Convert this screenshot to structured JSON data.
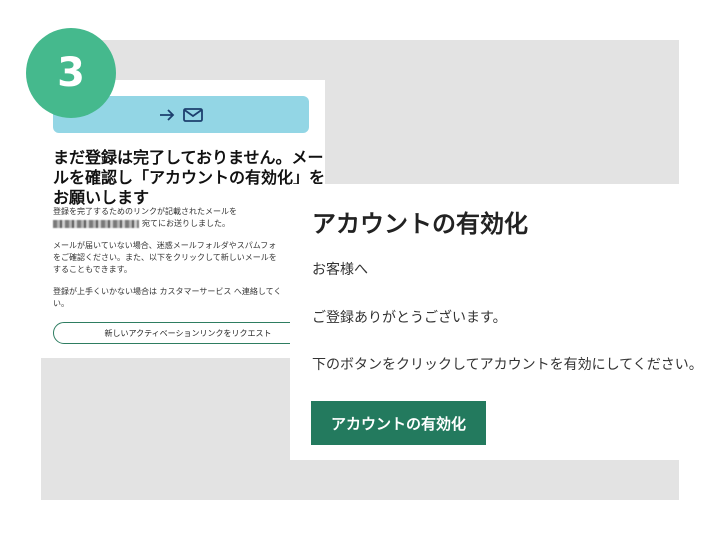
{
  "step": {
    "number": "3"
  },
  "email_preview": {
    "heading": "まだ登録は完了しておりません。メールを確認し「アカウントの有効化」をお願いします",
    "lines": [
      "登録を完了するためのリンクが記載されたメールを",
      "宛てにお送りしました。",
      "メールが届いていない場合、迷惑メールフォルダやスパムフォ",
      "をご確認ください。また、以下をクリックして新しいメールを",
      "することもできます。",
      "登録が上手くいかない場合は カスタマーサービス へ連絡してく",
      "い。"
    ],
    "request_button_label": "新しいアクティベーションリンクをリクエスト",
    "icons": [
      "arrow-right-icon",
      "envelope-icon"
    ]
  },
  "activation_email": {
    "title": "アカウントの有効化",
    "greeting": "お客様へ",
    "thanks": "ご登録ありがとうございます。",
    "instruction": "下のボタンをクリックしてアカウントを有効にしてください。",
    "button_label": "アカウントの有効化"
  },
  "colors": {
    "badge": "#45b98d",
    "banner": "#93d6e5",
    "button": "#237a5e",
    "background_panel": "#e3e3e3"
  }
}
